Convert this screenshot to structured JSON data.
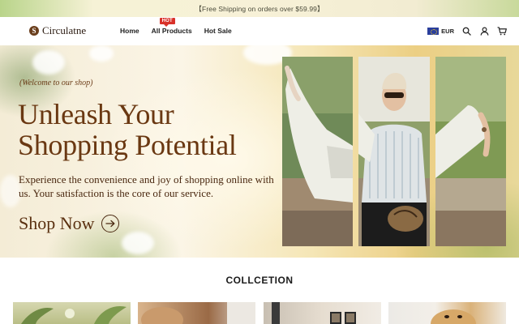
{
  "announcement": {
    "text": "【Free Shipping on orders over $59.99】"
  },
  "header": {
    "logo_text": "Circulatne",
    "logo_mark": "S",
    "nav": [
      {
        "label": "Home"
      },
      {
        "label": "All Products",
        "badge": "HOT"
      },
      {
        "label": "Hot Sale"
      }
    ],
    "currency": "EUR",
    "icons": [
      "eu-flag-icon",
      "search-icon",
      "user-icon",
      "cart-icon"
    ]
  },
  "hero": {
    "welcome": "(Welcome to our shop)",
    "headline_line1": "Unleash Your",
    "headline_line2": "Shopping Potential",
    "subtext": "Experience the convenience and joy of shopping online with us. Your satisfaction is the core of our service.",
    "cta_label": "Shop Now"
  },
  "collection": {
    "title": "COLLCETION"
  },
  "colors": {
    "brand_brown": "#6a3812",
    "hot_badge": "#d9322a",
    "announcement_text": "#4a4a3a"
  }
}
